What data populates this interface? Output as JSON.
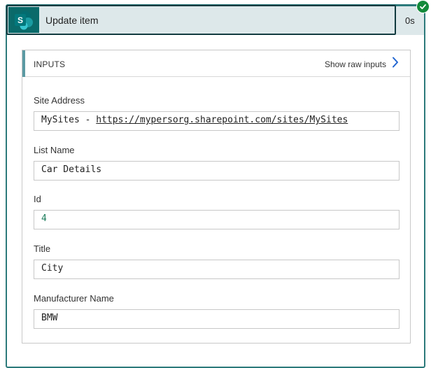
{
  "header": {
    "title": "Update item",
    "duration": "0s",
    "connector_icon": "sharepoint-icon",
    "status_icon": "check-circle-icon",
    "status_color": "#138a3a"
  },
  "inputs": {
    "title": "INPUTS",
    "show_raw_label": "Show raw inputs",
    "show_raw_icon": "chevron-right-icon",
    "fields": {
      "site_address": {
        "label": "Site Address",
        "prefix": "MySites - ",
        "link": "https://mypersorg.sharepoint.com/sites/MySites"
      },
      "list_name": {
        "label": "List Name",
        "value": "Car Details"
      },
      "id": {
        "label": "Id",
        "value": "4"
      },
      "title": {
        "label": "Title",
        "value": "City"
      },
      "manufacturer_name": {
        "label": "Manufacturer Name",
        "value": "BMW"
      }
    }
  }
}
